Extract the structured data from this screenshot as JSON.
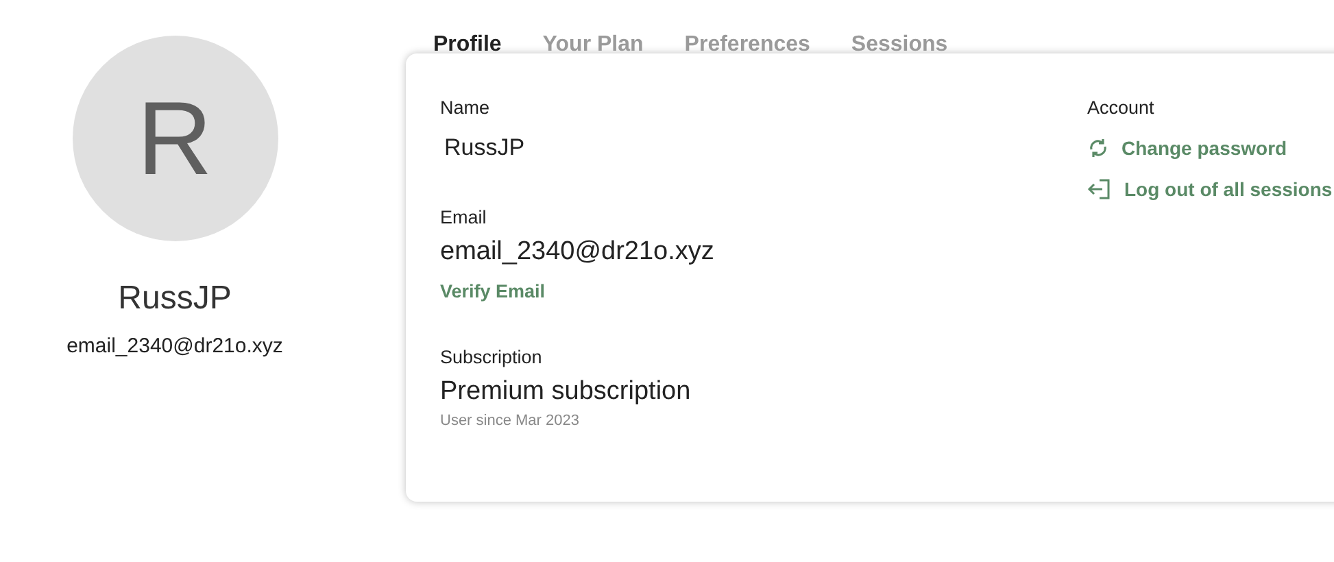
{
  "profile": {
    "avatar_initial": "R",
    "name": "RussJP",
    "email": "email_2340@dr21o.xyz"
  },
  "tabs": [
    {
      "label": "Profile",
      "selected": true
    },
    {
      "label": "Your Plan",
      "selected": false
    },
    {
      "label": "Preferences",
      "selected": false
    },
    {
      "label": "Sessions",
      "selected": false
    }
  ],
  "details": {
    "name_label": "Name",
    "name_value": "RussJP",
    "email_label": "Email",
    "email_value": "email_2340@dr21o.xyz",
    "verify_link": "Verify Email",
    "subscription_label": "Subscription",
    "subscription_value": "Premium subscription",
    "member_since": "User since Mar 2023"
  },
  "account": {
    "heading": "Account",
    "links": [
      {
        "kind": "refresh",
        "label": "Change password"
      },
      {
        "kind": "logout",
        "label": "Log out of all sessions"
      }
    ]
  }
}
